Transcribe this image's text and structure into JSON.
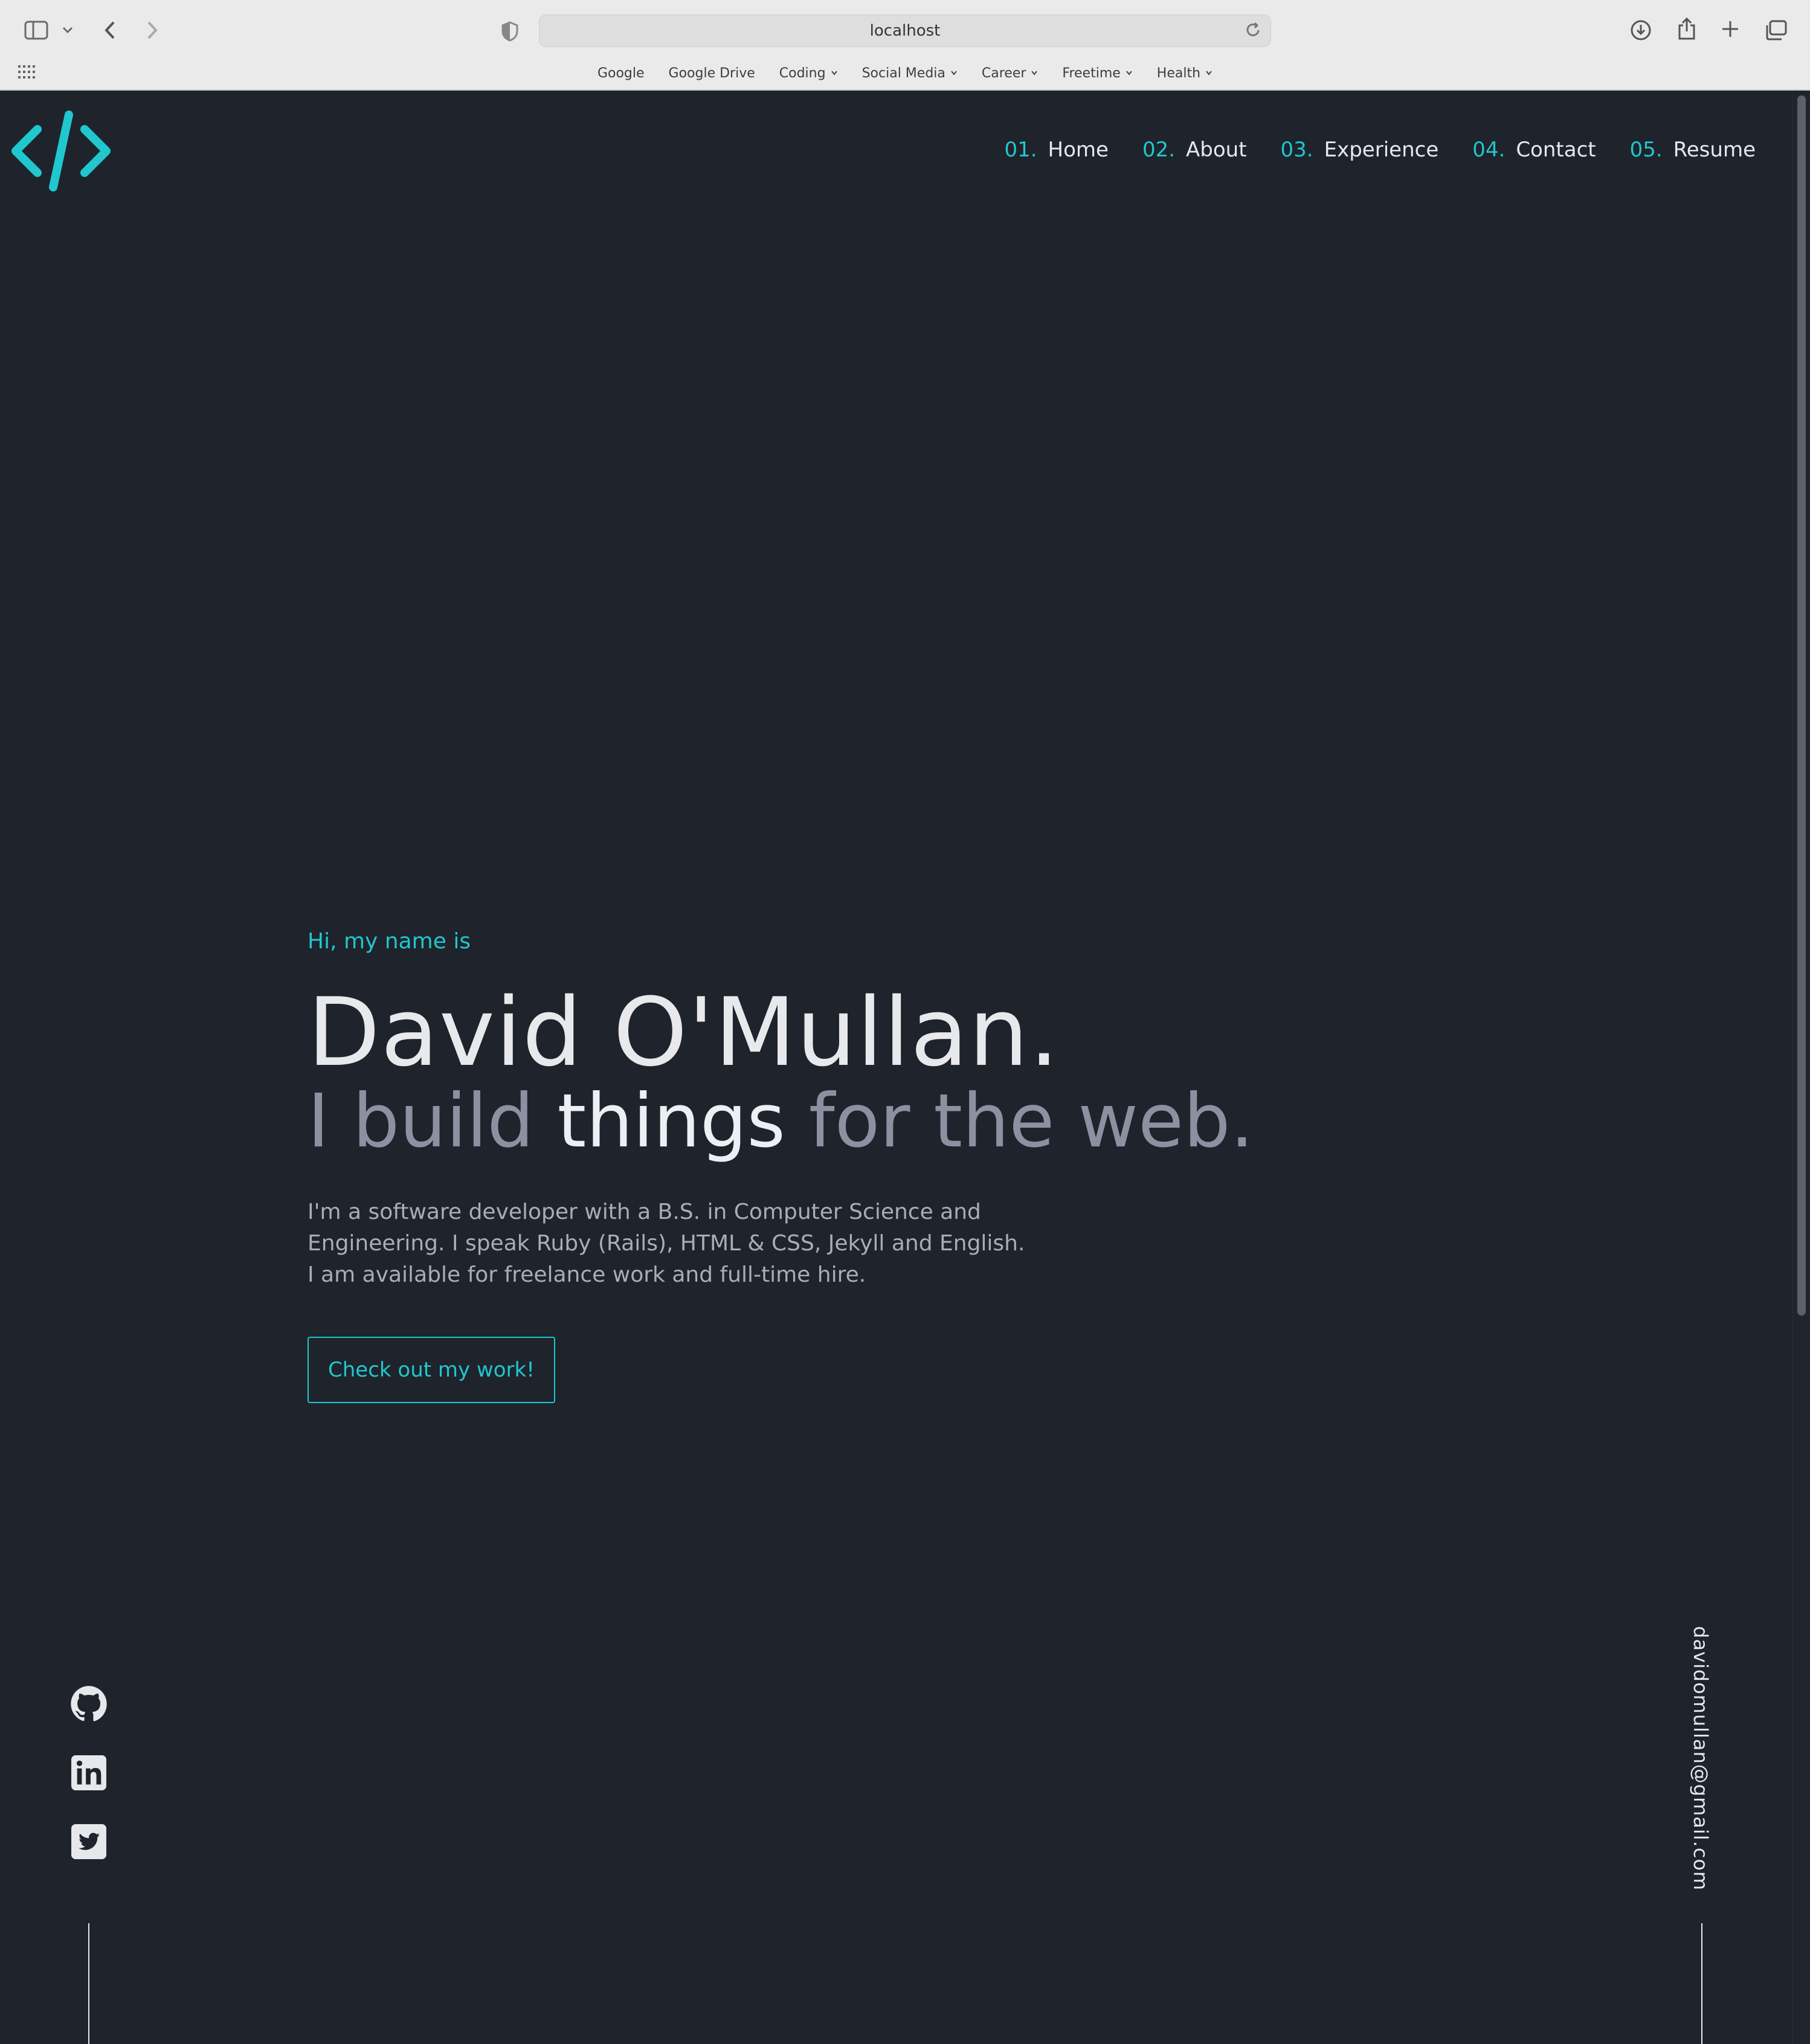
{
  "browser": {
    "url": "localhost",
    "bookmarks": [
      {
        "label": "Google",
        "dropdown": false
      },
      {
        "label": "Google Drive",
        "dropdown": false
      },
      {
        "label": "Coding",
        "dropdown": true
      },
      {
        "label": "Social Media",
        "dropdown": true
      },
      {
        "label": "Career",
        "dropdown": true
      },
      {
        "label": "Freetime",
        "dropdown": true
      },
      {
        "label": "Health",
        "dropdown": true
      }
    ]
  },
  "nav": {
    "items": [
      {
        "num": "01.",
        "label": "Home"
      },
      {
        "num": "02.",
        "label": "About"
      },
      {
        "num": "03.",
        "label": "Experience"
      },
      {
        "num": "04.",
        "label": "Contact"
      },
      {
        "num": "05.",
        "label": "Resume"
      }
    ]
  },
  "hero": {
    "intro": "Hi, my name is",
    "name": "David O'Mullan.",
    "tagline_pre": "I build ",
    "tagline_highlight": "things",
    "tagline_post": " for the web.",
    "description": "I'm a software developer with a B.S. in Computer Science and Engineering. I speak Ruby (Rails), HTML & CSS, Jekyll and English. I am available for freelance work and full-time hire.",
    "cta_label": "Check out my work!"
  },
  "socials": [
    {
      "icon": "github-icon"
    },
    {
      "icon": "linkedin-icon"
    },
    {
      "icon": "twitter-icon"
    }
  ],
  "email": "davidomullan@gmail.com",
  "colors": {
    "accent": "#20c7cf",
    "background": "#1f232b",
    "text": "#e8e9ec",
    "muted": "#8c91a2"
  }
}
